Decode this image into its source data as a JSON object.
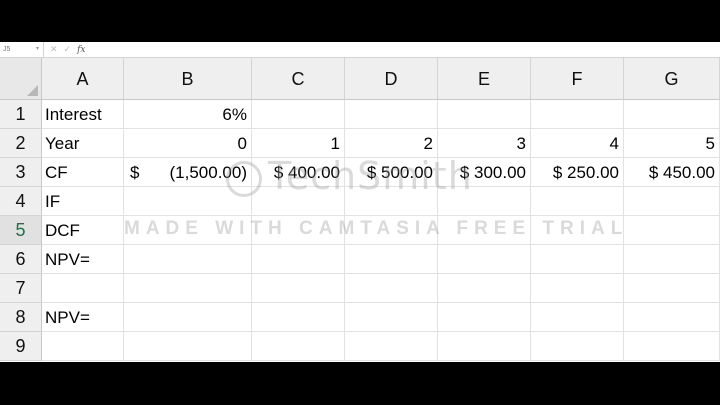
{
  "formula_bar": {
    "name_box": "J5",
    "fx": "fx",
    "icons": [
      "cancel-icon",
      "enter-icon"
    ]
  },
  "columns": [
    "A",
    "B",
    "C",
    "D",
    "E",
    "F",
    "G"
  ],
  "rows": [
    "1",
    "2",
    "3",
    "4",
    "5",
    "6",
    "7",
    "8",
    "9"
  ],
  "selected_row": "5",
  "cells": {
    "A1": "Interest",
    "B1": "6%",
    "A2": "Year",
    "B2": "0",
    "C2": "1",
    "D2": "2",
    "E2": "3",
    "F2": "4",
    "G2": "5",
    "A3": "CF",
    "B3_sym": "$",
    "B3_num": "(1,500.00)",
    "C3": "$ 400.00",
    "D3": "$ 500.00",
    "E3": "$ 300.00",
    "F3": "$ 250.00",
    "G3": "$ 450.00",
    "A4": "IF",
    "A5": "DCF",
    "A6": "NPV=",
    "A8": "NPV="
  },
  "watermark": {
    "logo": "TechSmith",
    "text": "MADE WITH CAMTASIA FREE TRIAL"
  }
}
